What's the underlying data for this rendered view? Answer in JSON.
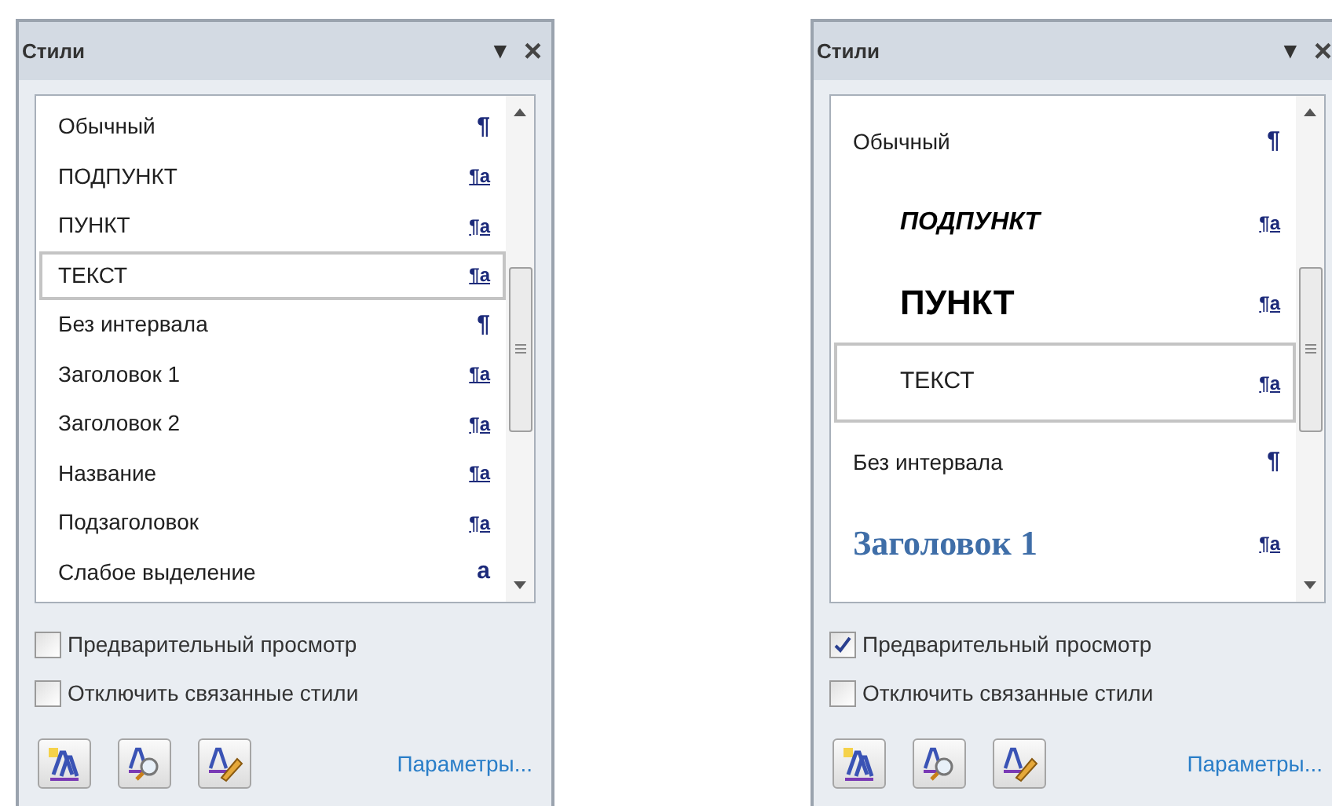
{
  "panels": [
    {
      "title": "Стили",
      "menu_glyph": "▼",
      "close_glyph": "×",
      "styles": [
        {
          "name": "Обычный",
          "mark": "¶",
          "linked": false,
          "selected": false
        },
        {
          "name": "ПОДПУНКТ",
          "mark": "¶a",
          "linked": true,
          "selected": false
        },
        {
          "name": "ПУНКТ",
          "mark": "¶a",
          "linked": true,
          "selected": false
        },
        {
          "name": "ТЕКСТ",
          "mark": "¶a",
          "linked": true,
          "selected": true
        },
        {
          "name": "Без интервала",
          "mark": "¶",
          "linked": false,
          "selected": false
        },
        {
          "name": "Заголовок 1",
          "mark": "¶a",
          "linked": true,
          "selected": false
        },
        {
          "name": "Заголовок 2",
          "mark": "¶a",
          "linked": true,
          "selected": false
        },
        {
          "name": "Название",
          "mark": "¶a",
          "linked": true,
          "selected": false
        },
        {
          "name": "Подзаголовок",
          "mark": "¶a",
          "linked": true,
          "selected": false
        },
        {
          "name": "Слабое выделение",
          "mark": "a",
          "linked": false,
          "selected": false
        }
      ],
      "options": [
        {
          "label": "Предварительный просмотр",
          "checked": false
        },
        {
          "label": "Отключить связанные стили",
          "checked": false
        }
      ],
      "link": "Параметры..."
    },
    {
      "title": "Стили",
      "menu_glyph": "▼",
      "close_glyph": "×",
      "styles": [
        {
          "name": "Обычный",
          "kind": "plain",
          "mark": "¶",
          "linked": false,
          "selected": false
        },
        {
          "name": "ПОДПУНКТ",
          "kind": "emphasis",
          "mark": "¶a",
          "linked": true,
          "selected": false
        },
        {
          "name": "ПУНКТ",
          "kind": "strong",
          "mark": "¶a",
          "linked": true,
          "selected": false
        },
        {
          "name": "ТЕКСТ",
          "kind": "indented",
          "mark": "¶a",
          "linked": true,
          "selected": true
        },
        {
          "name": "Без интервала",
          "kind": "plain",
          "mark": "¶",
          "linked": false,
          "selected": false
        },
        {
          "name": "Заголовок 1",
          "kind": "heading",
          "mark": "¶a",
          "linked": true,
          "selected": false
        }
      ],
      "options": [
        {
          "label": "Предварительный просмотр",
          "checked": true
        },
        {
          "label": "Отключить связанные стили",
          "checked": false
        }
      ],
      "link": "Параметры..."
    }
  ]
}
